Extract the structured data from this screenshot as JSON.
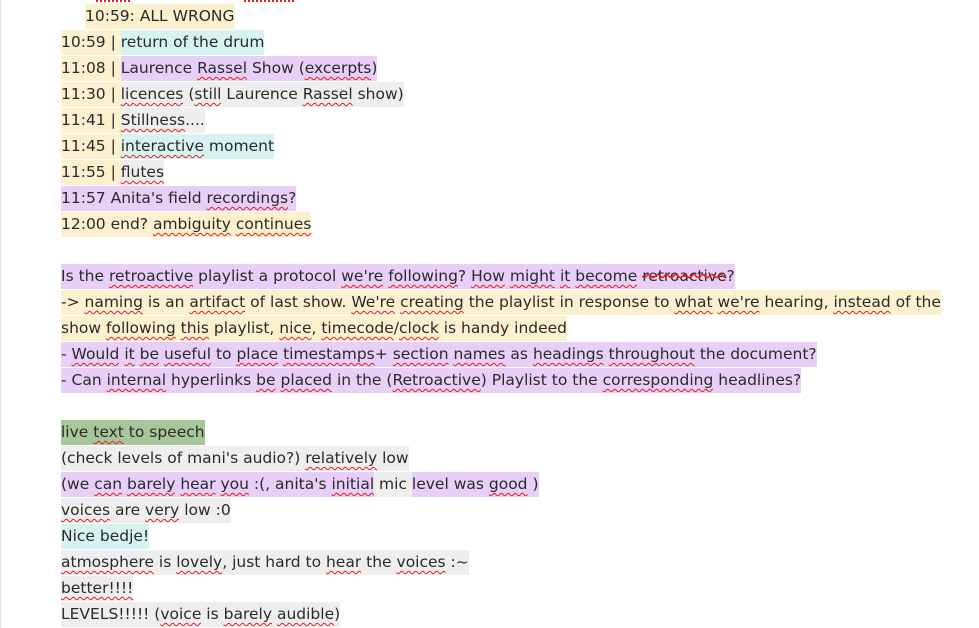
{
  "document": {
    "lines": [
      {
        "indent": true,
        "segments": [
          {
            "text": "10:59: ALL WRONG",
            "bg": "y"
          }
        ]
      },
      {
        "segments": [
          {
            "text": "10:59 | ",
            "bg": "y"
          },
          {
            "text": "return of the drum",
            "bg": "c"
          }
        ]
      },
      {
        "segments": [
          {
            "text": "11:08 | ",
            "bg": "y"
          },
          {
            "text": "Laurence ",
            "bg": "p"
          },
          {
            "text": "Rassel",
            "bg": "p",
            "sq": true
          },
          {
            "text": " Show (",
            "bg": "p"
          },
          {
            "text": "excerpts",
            "bg": "p",
            "sq": true
          },
          {
            "text": ")",
            "bg": "p"
          }
        ]
      },
      {
        "segments": [
          {
            "text": "11:30 | ",
            "bg": "y"
          },
          {
            "text": "licences",
            "bg": "g",
            "sq": true
          },
          {
            "text": " (",
            "bg": "g"
          },
          {
            "text": "still",
            "bg": "g",
            "sq": true
          },
          {
            "text": " Laurence ",
            "bg": "g"
          },
          {
            "text": "Rassel",
            "bg": "g",
            "sq": true
          },
          {
            "text": " show)",
            "bg": "g"
          }
        ]
      },
      {
        "segments": [
          {
            "text": "11:41 | ",
            "bg": "y"
          },
          {
            "text": "Stillness",
            "bg": "g",
            "sq": true
          },
          {
            "text": "....",
            "bg": "g"
          }
        ]
      },
      {
        "segments": [
          {
            "text": "11:45 | ",
            "bg": "y"
          },
          {
            "text": "interactive",
            "bg": "c",
            "sq": true
          },
          {
            "text": " moment",
            "bg": "c"
          }
        ]
      },
      {
        "segments": [
          {
            "text": "11:55 | ",
            "bg": "y"
          },
          {
            "text": "flutes",
            "bg": "g",
            "sq": true
          }
        ]
      },
      {
        "segments": [
          {
            "text": "11:57 Anita's field ",
            "bg": "p"
          },
          {
            "text": "recordings",
            "bg": "p",
            "sq": true
          },
          {
            "text": "?",
            "bg": "p"
          }
        ]
      },
      {
        "segments": [
          {
            "text": "12:00 end? ",
            "bg": "y"
          },
          {
            "text": "ambiguity",
            "bg": "y",
            "sq": true
          },
          {
            "text": " ",
            "bg": "y"
          },
          {
            "text": "continues",
            "bg": "y",
            "sq": true
          }
        ]
      },
      {
        "blank": true
      },
      {
        "segments": [
          {
            "text": "Is the ",
            "bg": "p"
          },
          {
            "text": "retroactive",
            "bg": "p",
            "sq": true
          },
          {
            "text": " playlist a protocol ",
            "bg": "p"
          },
          {
            "text": "we're",
            "bg": "p",
            "sq": true
          },
          {
            "text": " ",
            "bg": "p"
          },
          {
            "text": "following",
            "bg": "p",
            "sq": true
          },
          {
            "text": "? ",
            "bg": "p"
          },
          {
            "text": "How",
            "bg": "p",
            "sq": true
          },
          {
            "text": " ",
            "bg": "p"
          },
          {
            "text": "might",
            "bg": "p",
            "sq": true
          },
          {
            "text": " ",
            "bg": "p"
          },
          {
            "text": "it",
            "bg": "p",
            "sq": true
          },
          {
            "text": " ",
            "bg": "p"
          },
          {
            "text": "become",
            "bg": "p",
            "sq": true
          },
          {
            "text": " ",
            "bg": "p"
          },
          {
            "text": "retroactive",
            "bg": "p",
            "st": true
          },
          {
            "text": "?",
            "bg": "p"
          }
        ]
      },
      {
        "segments": [
          {
            "text": "-> ",
            "bg": "y"
          },
          {
            "text": "naming",
            "bg": "y",
            "sq": true
          },
          {
            "text": " is an ",
            "bg": "y"
          },
          {
            "text": "artifact",
            "bg": "y",
            "sq": true
          },
          {
            "text": " of last show. ",
            "bg": "y"
          },
          {
            "text": "We're",
            "bg": "y",
            "sq": true
          },
          {
            "text": " ",
            "bg": "y"
          },
          {
            "text": "creating",
            "bg": "y",
            "sq": true
          },
          {
            "text": " the playlist in response to ",
            "bg": "y"
          },
          {
            "text": "what",
            "bg": "y",
            "sq": true
          },
          {
            "text": " ",
            "bg": "y"
          },
          {
            "text": "we're",
            "bg": "y",
            "sq": true
          },
          {
            "text": " hearing, ",
            "bg": "y"
          },
          {
            "text": "instead",
            "bg": "y",
            "sq": true
          },
          {
            "text": " of the",
            "bg": "y"
          }
        ]
      },
      {
        "segments": [
          {
            "text": "show ",
            "bg": "y"
          },
          {
            "text": "following",
            "bg": "y",
            "sq": true
          },
          {
            "text": " ",
            "bg": "y"
          },
          {
            "text": "this",
            "bg": "y",
            "sq": true
          },
          {
            "text": " playlist, ",
            "bg": "y"
          },
          {
            "text": "nice",
            "bg": "y",
            "sq": true
          },
          {
            "text": ", ",
            "bg": "y"
          },
          {
            "text": "timecode",
            "bg": "y",
            "sq": true
          },
          {
            "text": "/",
            "bg": "y"
          },
          {
            "text": "clock",
            "bg": "y",
            "sq": true
          },
          {
            "text": " is handy indeed",
            "bg": "y"
          }
        ]
      },
      {
        "segments": [
          {
            "text": "- ",
            "bg": "p"
          },
          {
            "text": "Would",
            "bg": "p",
            "sq": true
          },
          {
            "text": " ",
            "bg": "p"
          },
          {
            "text": "it",
            "bg": "p",
            "sq": true
          },
          {
            "text": " ",
            "bg": "p"
          },
          {
            "text": "be",
            "bg": "p",
            "sq": true
          },
          {
            "text": " ",
            "bg": "p"
          },
          {
            "text": "useful",
            "bg": "p",
            "sq": true
          },
          {
            "text": " to ",
            "bg": "p"
          },
          {
            "text": "place",
            "bg": "p",
            "sq": true
          },
          {
            "text": " ",
            "bg": "p"
          },
          {
            "text": "timestamps",
            "bg": "p",
            "sq": true
          },
          {
            "text": "+ ",
            "bg": "p"
          },
          {
            "text": "section",
            "bg": "p",
            "sq": true
          },
          {
            "text": " ",
            "bg": "p"
          },
          {
            "text": "names",
            "bg": "p",
            "sq": true
          },
          {
            "text": " as ",
            "bg": "p"
          },
          {
            "text": "headings",
            "bg": "p",
            "sq": true
          },
          {
            "text": " ",
            "bg": "p"
          },
          {
            "text": "throughout",
            "bg": "p",
            "sq": true
          },
          {
            "text": " the document?",
            "bg": "p"
          }
        ]
      },
      {
        "segments": [
          {
            "text": "- Can ",
            "bg": "p"
          },
          {
            "text": "internal",
            "bg": "p",
            "sq": true
          },
          {
            "text": " hyperlinks ",
            "bg": "p"
          },
          {
            "text": "be",
            "bg": "p",
            "sq": true
          },
          {
            "text": " ",
            "bg": "p"
          },
          {
            "text": "placed",
            "bg": "p",
            "sq": true
          },
          {
            "text": " in the (",
            "bg": "p"
          },
          {
            "text": "Retroactive",
            "bg": "p",
            "sq": true
          },
          {
            "text": ") Playlist to the ",
            "bg": "p"
          },
          {
            "text": "corresponding",
            "bg": "p",
            "sq": true
          },
          {
            "text": " headlines?",
            "bg": "p"
          }
        ]
      },
      {
        "blank": true
      },
      {
        "segments": [
          {
            "text": "live ",
            "bg": "gr"
          },
          {
            "text": "text",
            "bg": "gr",
            "sq": true
          },
          {
            "text": " to speech",
            "bg": "gr"
          }
        ]
      },
      {
        "segments": [
          {
            "text": "(check levels of mani's audio?) ",
            "bg": "g"
          },
          {
            "text": "relatively",
            "bg": "g",
            "sq": true
          },
          {
            "text": " low",
            "bg": "g"
          }
        ]
      },
      {
        "segments": [
          {
            "text": "(we ",
            "bg": "p"
          },
          {
            "text": "can",
            "bg": "p",
            "sq": true
          },
          {
            "text": " ",
            "bg": "p"
          },
          {
            "text": "barely",
            "bg": "p",
            "sq": true
          },
          {
            "text": " ",
            "bg": "p"
          },
          {
            "text": "hear",
            "bg": "p",
            "sq": true
          },
          {
            "text": " ",
            "bg": "p"
          },
          {
            "text": "you",
            "bg": "p",
            "sq": true
          },
          {
            "text": " :(, anita's ",
            "bg": "p"
          },
          {
            "text": "initial",
            "bg": "p",
            "sq": true
          },
          {
            "text": " mic ",
            "bg": "g"
          },
          {
            "text": "level was ",
            "bg": "p"
          },
          {
            "text": "good",
            "bg": "p",
            "sq": true
          },
          {
            "text": " )",
            "bg": "p"
          }
        ]
      },
      {
        "segments": [
          {
            "text": "voices",
            "bg": "g",
            "sq": true
          },
          {
            "text": " are ",
            "bg": "g"
          },
          {
            "text": "very",
            "bg": "g",
            "sq": true
          },
          {
            "text": " low :0",
            "bg": "g"
          }
        ]
      },
      {
        "segments": [
          {
            "text": "Nice bedje!",
            "bg": "c"
          }
        ]
      },
      {
        "segments": [
          {
            "text": "atmosphere",
            "bg": "g",
            "sq": true
          },
          {
            "text": " is ",
            "bg": "g"
          },
          {
            "text": "lovely",
            "bg": "g",
            "sq": true
          },
          {
            "text": ", just hard to ",
            "bg": "g"
          },
          {
            "text": "hear",
            "bg": "g",
            "sq": true
          },
          {
            "text": " the ",
            "bg": "g"
          },
          {
            "text": "voices",
            "bg": "g",
            "sq": true
          },
          {
            "text": " :~",
            "bg": "g"
          }
        ]
      },
      {
        "segments": [
          {
            "text": "better!!!!",
            "bg": "g",
            "sq": true
          }
        ]
      },
      {
        "segments": [
          {
            "text": "LEVELS!!!!! (",
            "bg": "g"
          },
          {
            "text": "voice",
            "bg": "g",
            "sq": true
          },
          {
            "text": " is ",
            "bg": "g"
          },
          {
            "text": "barely",
            "bg": "g",
            "sq": true
          },
          {
            "text": " ",
            "bg": "g"
          },
          {
            "text": "audible",
            "bg": "g",
            "sq": true
          },
          {
            "text": ")",
            "bg": "g"
          }
        ]
      }
    ]
  },
  "colors": {
    "y": "#fbf1cf",
    "c": "#d6f3f1",
    "p": "#e8cff7",
    "g": "#eeeeee",
    "gr": "#a7c79a",
    "spellcheck": "#e21d1d"
  }
}
